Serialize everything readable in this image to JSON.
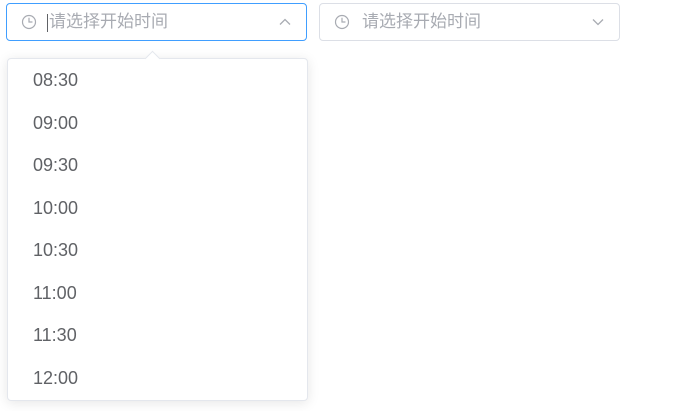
{
  "start_picker": {
    "placeholder": "请选择开始时间",
    "icon": "clock-icon",
    "chevron": "chevron-up-icon",
    "focused": true
  },
  "end_picker": {
    "placeholder": "请选择开始时间",
    "icon": "clock-icon",
    "chevron": "chevron-down-icon",
    "focused": false
  },
  "dropdown": {
    "options": [
      {
        "label": "08:30"
      },
      {
        "label": "09:00"
      },
      {
        "label": "09:30"
      },
      {
        "label": "10:00"
      },
      {
        "label": "10:30"
      },
      {
        "label": "11:00"
      },
      {
        "label": "11:30"
      },
      {
        "label": "12:00"
      }
    ]
  },
  "colors": {
    "focus_border": "#409eff",
    "border": "#dcdfe6",
    "placeholder": "#a8abb2",
    "text": "#606266"
  }
}
